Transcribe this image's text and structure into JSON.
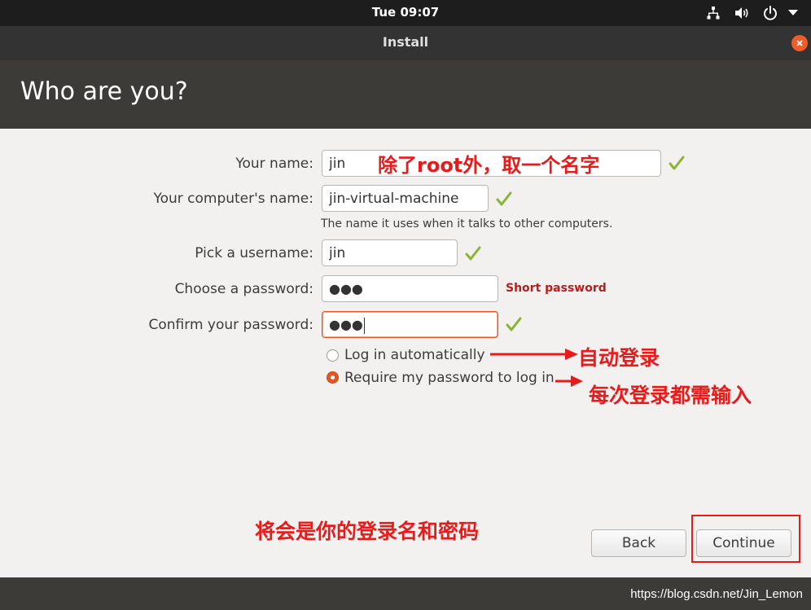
{
  "topbar": {
    "clock": "Tue 09:07",
    "icons": [
      "network-icon",
      "volume-icon",
      "power-icon",
      "chevron-down-icon"
    ]
  },
  "window": {
    "title": "Install",
    "close_icon": "close-icon"
  },
  "page": {
    "title": "Who are you?"
  },
  "form": {
    "name_label": "Your name:",
    "name_value": "jin",
    "computer_label": "Your computer's name:",
    "computer_value": "jin-virtual-machine",
    "computer_hint": "The name it uses when it talks to other computers.",
    "username_label": "Pick a username:",
    "username_value": "jin",
    "password_label": "Choose a password:",
    "password_value": "●●●",
    "password_strength": "Short password",
    "confirm_label": "Confirm your password:",
    "confirm_value": "●●●",
    "login_options": [
      {
        "label": "Log in automatically",
        "selected": false
      },
      {
        "label": "Require my password to log in",
        "selected": true
      }
    ]
  },
  "annotations": {
    "name_note": "除了root外，取一个名字",
    "auto_login_note": "自动登录",
    "require_password_note": "每次登录都需输入",
    "login_name_note": "将会是你的登录名和密码"
  },
  "buttons": {
    "back": "Back",
    "continue": "Continue"
  },
  "footer": {
    "watermark": "https://blog.csdn.net/Jin_Lemon"
  },
  "colors": {
    "accent": "#e95420",
    "header_bg": "#3c3b37",
    "topbar_bg": "#1d1d1d",
    "annotation_red": "#e81b1b",
    "check_green": "#8ab435"
  }
}
